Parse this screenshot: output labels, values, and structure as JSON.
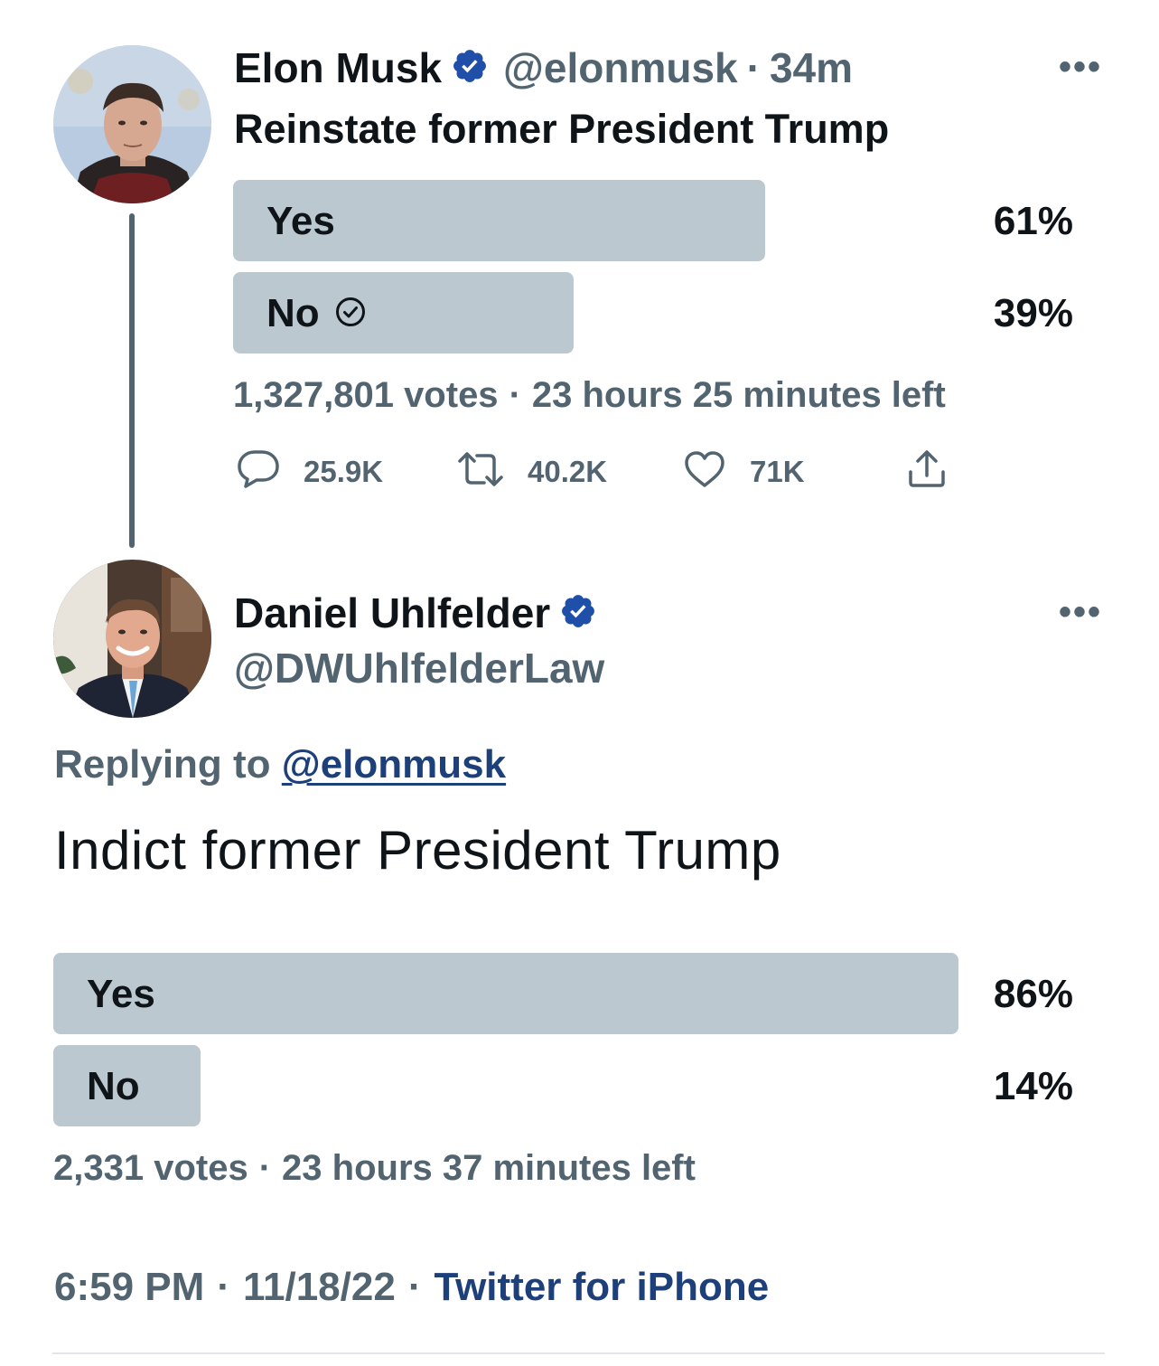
{
  "tweet1": {
    "author_name": "Elon Musk",
    "handle": "@elonmusk",
    "separator": "·",
    "time": "34m",
    "more_icon": "more-horizontal-icon",
    "text": "Reinstate former President Trump",
    "poll": {
      "options": [
        {
          "label": "Yes",
          "percent_text": "61%",
          "percent": 61,
          "voted": false
        },
        {
          "label": "No",
          "percent_text": "39%",
          "percent": 39,
          "voted": true
        }
      ],
      "votes": "1,327,801 votes",
      "separator": "·",
      "time_left": "23 hours 25 minutes left"
    },
    "actions": {
      "replies": "25.9K",
      "retweets": "40.2K",
      "likes": "71K"
    }
  },
  "tweet2": {
    "author_name": "Daniel Uhlfelder",
    "handle": "@DWUhlfelderLaw",
    "more_icon": "more-horizontal-icon",
    "replying_prefix": "Replying to",
    "replying_to": "@elonmusk",
    "text": "Indict former President Trump",
    "poll": {
      "options": [
        {
          "label": "Yes",
          "percent_text": "86%",
          "percent": 86
        },
        {
          "label": "No",
          "percent_text": "14%",
          "percent": 14
        }
      ],
      "votes": "2,331 votes",
      "separator": "·",
      "time_left": "23 hours 37 minutes left"
    },
    "footer": {
      "time": "6:59 PM",
      "separator": "·",
      "date": "11/18/22",
      "source": "Twitter for iPhone"
    }
  },
  "colors": {
    "poll_bar": "#bcc8d0",
    "secondary_text": "#536471",
    "verified_badge": "#1f4fa8",
    "link": "#1d3f7a"
  }
}
